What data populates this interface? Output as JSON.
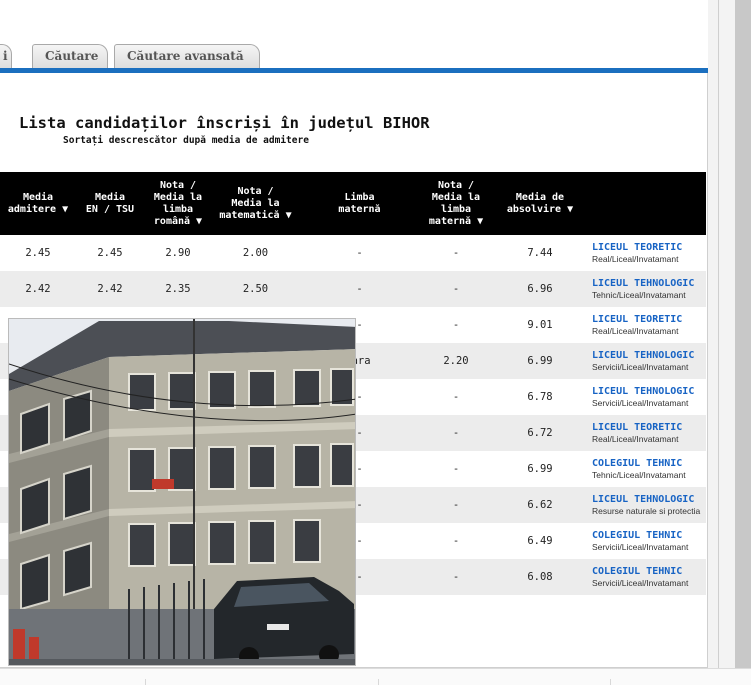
{
  "tabs": [
    {
      "label": "i"
    },
    {
      "label": "Căutare"
    },
    {
      "label": "Căutare avansată"
    }
  ],
  "page_title": "Lista candidaților înscriși în județul BIHOR",
  "subtitle": "Sortați descrescător după media de admitere",
  "columns": [
    {
      "line1": "Media",
      "line2": "admitere ▼"
    },
    {
      "line1": "Media",
      "line2": "EN / TSU"
    },
    {
      "line1": "Nota /",
      "line2": "Media la",
      "line3": "limba",
      "line4": "română ▼"
    },
    {
      "line1": "Nota /",
      "line2": "Media la",
      "line3": "matematică ▼"
    },
    {
      "line1": "Limba",
      "line2": "maternă"
    },
    {
      "line1": "Nota /",
      "line2": "Media la",
      "line3": "limba",
      "line4": "maternă ▼"
    },
    {
      "line1": "Media de",
      "line2": "absolvire ▼"
    },
    {
      "line1": ""
    }
  ],
  "rows": [
    {
      "admitere": "2.45",
      "en": "2.45",
      "romana": "2.90",
      "mate": "2.00",
      "limba": "-",
      "nota_lm": "-",
      "absolvire": "7.44",
      "school": "LICEUL TEORETIC",
      "type": "Real/Liceal/Invatamant"
    },
    {
      "admitere": "2.42",
      "en": "2.42",
      "romana": "2.35",
      "mate": "2.50",
      "limba": "-",
      "nota_lm": "-",
      "absolvire": "6.96",
      "school": "LICEUL TEHNOLOGIC",
      "type": "Tehnic/Liceal/Invatamant"
    },
    {
      "admitere": "",
      "en": "",
      "romana": "",
      "mate": "",
      "limba": "-",
      "nota_lm": "-",
      "absolvire": "9.01",
      "school": "LICEUL TEORETIC",
      "type": "Real/Liceal/Invatamant"
    },
    {
      "admitere": "",
      "en": "",
      "romana": "",
      "mate": "",
      "limba": "ba maghiara",
      "nota_lm": "2.20",
      "absolvire": "6.99",
      "school": "LICEUL TEHNOLOGIC",
      "type": "Servicii/Liceal/Invatamant"
    },
    {
      "admitere": "",
      "en": "",
      "romana": "",
      "mate": "",
      "limba": "-",
      "nota_lm": "-",
      "absolvire": "6.78",
      "school": "LICEUL TEHNOLOGIC",
      "type": "Servicii/Liceal/Invatamant"
    },
    {
      "admitere": "",
      "en": "",
      "romana": "",
      "mate": "",
      "limba": "-",
      "nota_lm": "-",
      "absolvire": "6.72",
      "school": "LICEUL TEORETIC",
      "type": "Real/Liceal/Invatamant"
    },
    {
      "admitere": "",
      "en": "",
      "romana": "",
      "mate": "",
      "limba": "-",
      "nota_lm": "-",
      "absolvire": "6.99",
      "school": "COLEGIUL TEHNIC",
      "type": "Tehnic/Liceal/Invatamant"
    },
    {
      "admitere": "",
      "en": "",
      "romana": "",
      "mate": "",
      "limba": "-",
      "nota_lm": "-",
      "absolvire": "6.62",
      "school": "LICEUL TEHNOLOGIC",
      "type": "Resurse naturale si protectia"
    },
    {
      "admitere": "",
      "en": "",
      "romana": "",
      "mate": "",
      "limba": "-",
      "nota_lm": "-",
      "absolvire": "6.49",
      "school": "COLEGIUL TEHNIC",
      "type": "Servicii/Liceal/Invatamant"
    },
    {
      "admitere": "",
      "en": "",
      "romana": "",
      "mate": "",
      "limba": "-",
      "nota_lm": "-",
      "absolvire": "6.08",
      "school": "COLEGIUL TEHNIC",
      "type": "Servicii/Liceal/Invatamant"
    }
  ],
  "photo": {
    "icon": "school-building-photo"
  },
  "colors": {
    "header_bg": "#000000",
    "link": "#1763c4",
    "accent_bar": "#1b6fbf",
    "row_alt": "#ececec"
  }
}
